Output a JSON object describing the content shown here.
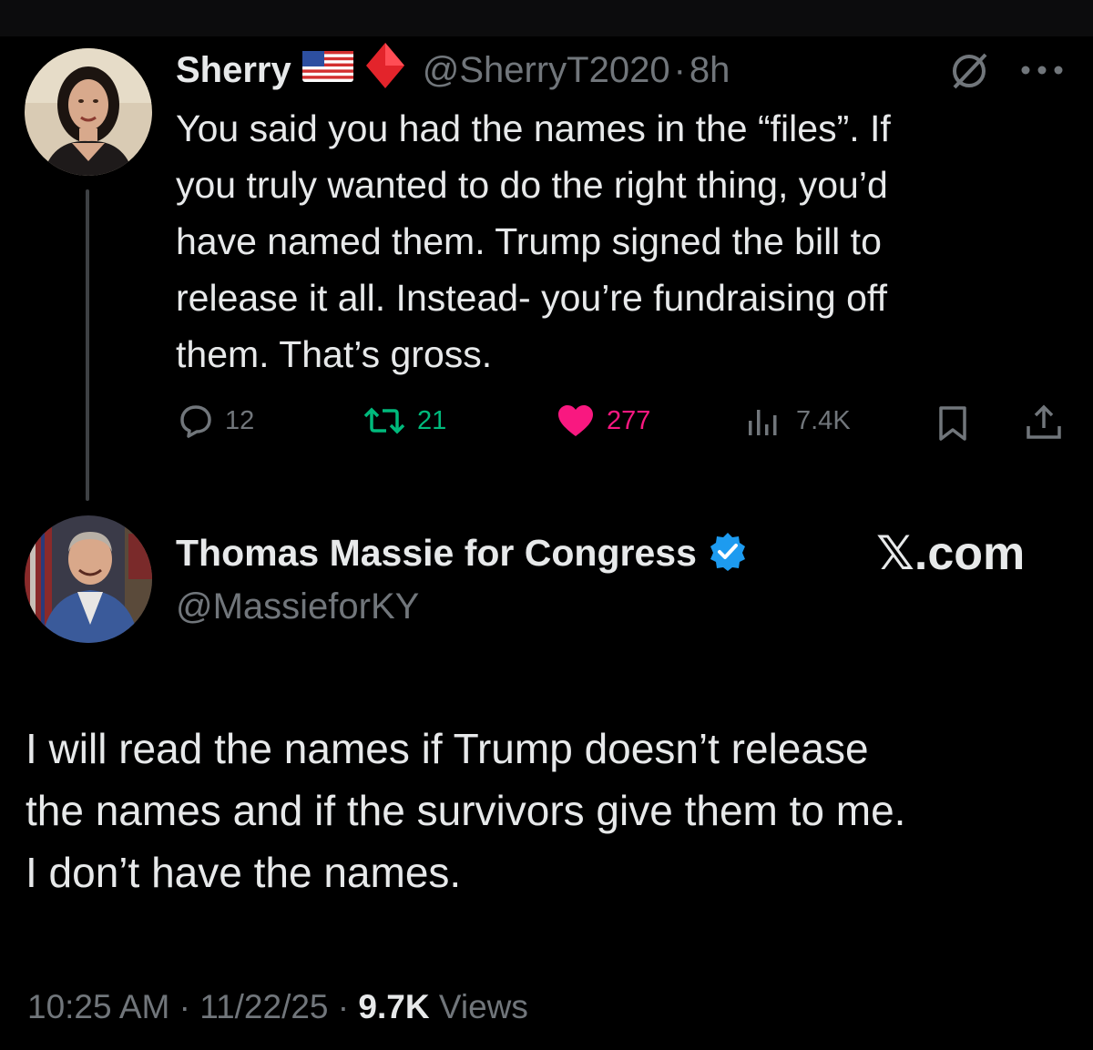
{
  "reply_to": {
    "display_name": "Sherry",
    "badges": [
      "flag-us-icon",
      "red-diamond-icon"
    ],
    "handle": "@SherryT2020",
    "separator": "·",
    "time": "8h",
    "text_lines": [
      "You said you had the names in the “files”. If",
      "you truly wanted to do the right thing, you’d",
      "have named them. Trump signed the bill to",
      "release it all. Instead- you’re fundraising off",
      "them. That’s gross."
    ],
    "stats": {
      "replies": "12",
      "reposts": "21",
      "likes": "277",
      "views": "7.4K"
    },
    "colors": {
      "repost": "#00ba7c",
      "like": "#f91880"
    }
  },
  "author": {
    "display_name": "Thomas Massie for Congress",
    "verified": true,
    "verified_color": "#1d9bf0",
    "handle": "@MassieforKY",
    "brand": "𝕏.com"
  },
  "tweet": {
    "text_lines": [
      "I will read the names if Trump doesn’t release",
      "the names and if the survivors give them to me.",
      "I don’t have the names."
    ],
    "time": "10:25 AM",
    "sep1": "·",
    "date": "11/22/25",
    "sep2": "·",
    "views_count": "9.7K",
    "views_label": "Views"
  }
}
